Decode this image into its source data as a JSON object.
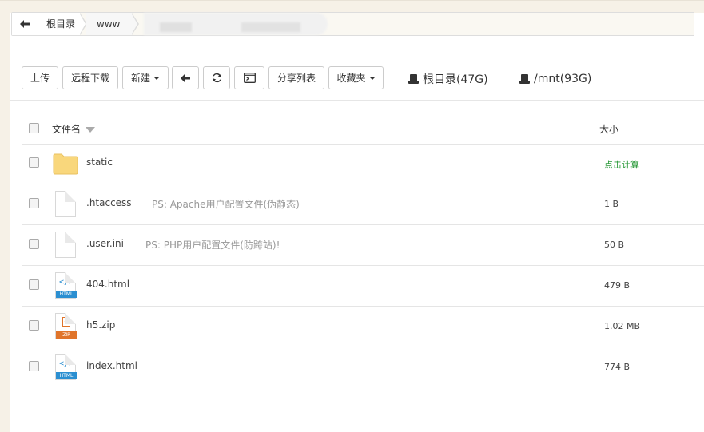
{
  "breadcrumb": {
    "items": [
      "根目录",
      "www"
    ]
  },
  "toolbar": {
    "upload": "上传",
    "remote_download": "远程下载",
    "new": "新建",
    "share_list": "分享列表",
    "favorites": "收藏夹"
  },
  "disks": [
    {
      "label": "根目录(47G)",
      "icon": "hdd-icon"
    },
    {
      "label": "/mnt(93G)",
      "icon": "hdd-icon"
    }
  ],
  "table": {
    "col_name": "文件名",
    "col_size": "大小",
    "rows": [
      {
        "name": "static",
        "note": "",
        "size": "点击计算",
        "type": "folder"
      },
      {
        "name": ".htaccess",
        "note": "PS: Apache用户配置文件(伪静态)",
        "size": "1 B",
        "type": "file"
      },
      {
        "name": ".user.ini",
        "note": "PS: PHP用户配置文件(防跨站)!",
        "size": "50 B",
        "type": "file"
      },
      {
        "name": "404.html",
        "note": "",
        "size": "479 B",
        "type": "html",
        "tag": "HTML"
      },
      {
        "name": "h5.zip",
        "note": "",
        "size": "1.02 MB",
        "type": "zip",
        "tag": "ZIP"
      },
      {
        "name": "index.html",
        "note": "",
        "size": "774 B",
        "type": "html",
        "tag": "HTML"
      }
    ]
  },
  "colors": {
    "link_green": "#2b9a3a",
    "folder_yellow": "#f9d77c",
    "html_tag": "#2b8fd1",
    "zip_tag": "#e0742a"
  }
}
